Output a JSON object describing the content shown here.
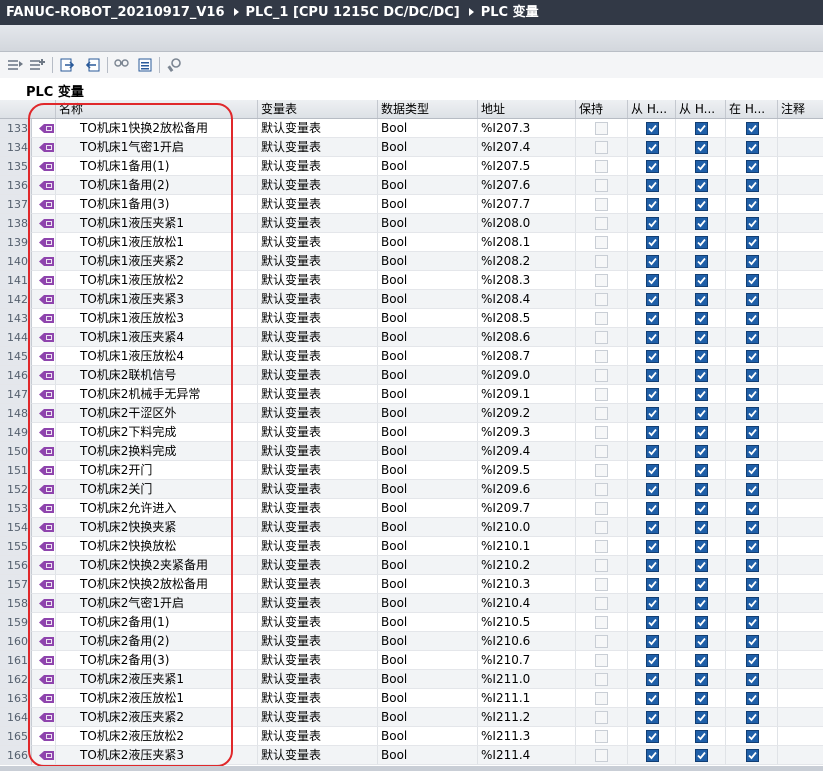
{
  "titlebar": {
    "crumbs": [
      "FANUC-ROBOT_20210917_V16",
      "PLC_1 [CPU 1215C DC/DC/DC]",
      "PLC 变量"
    ]
  },
  "section_title": "PLC 变量",
  "toolbar_icons": [
    "insert-row-icon",
    "add-row-icon",
    "export-icon",
    "import-icon",
    "monitor-icon",
    "show-all-icon",
    "settings-icon"
  ],
  "columns": {
    "name": "名称",
    "table": "变量表",
    "datatype": "数据类型",
    "address": "地址",
    "retain": "保持",
    "from_hmi1": "从 H...",
    "from_hmi2": "从 H...",
    "in_hmi": "在 H...",
    "comment": "注释"
  },
  "colors": {
    "titlebar_bg": "#323946",
    "checkbox_checked": "#1f5fa8",
    "highlight_box": "#e0282b",
    "tag_icon": "#8e44ad"
  },
  "rows": [
    {
      "n": "133",
      "name": "TO机床1快换2放松备用",
      "table": "默认变量表",
      "type": "Bool",
      "addr": "%I207.3",
      "retain": false,
      "h1": true,
      "h2": true,
      "h3": true
    },
    {
      "n": "134",
      "name": "TO机床1气密1开启",
      "table": "默认变量表",
      "type": "Bool",
      "addr": "%I207.4",
      "retain": false,
      "h1": true,
      "h2": true,
      "h3": true
    },
    {
      "n": "135",
      "name": "TO机床1备用(1)",
      "table": "默认变量表",
      "type": "Bool",
      "addr": "%I207.5",
      "retain": false,
      "h1": true,
      "h2": true,
      "h3": true
    },
    {
      "n": "136",
      "name": "TO机床1备用(2)",
      "table": "默认变量表",
      "type": "Bool",
      "addr": "%I207.6",
      "retain": false,
      "h1": true,
      "h2": true,
      "h3": true
    },
    {
      "n": "137",
      "name": "TO机床1备用(3)",
      "table": "默认变量表",
      "type": "Bool",
      "addr": "%I207.7",
      "retain": false,
      "h1": true,
      "h2": true,
      "h3": true
    },
    {
      "n": "138",
      "name": "TO机床1液压夹紧1",
      "table": "默认变量表",
      "type": "Bool",
      "addr": "%I208.0",
      "retain": false,
      "h1": true,
      "h2": true,
      "h3": true
    },
    {
      "n": "139",
      "name": "TO机床1液压放松1",
      "table": "默认变量表",
      "type": "Bool",
      "addr": "%I208.1",
      "retain": false,
      "h1": true,
      "h2": true,
      "h3": true
    },
    {
      "n": "140",
      "name": "TO机床1液压夹紧2",
      "table": "默认变量表",
      "type": "Bool",
      "addr": "%I208.2",
      "retain": false,
      "h1": true,
      "h2": true,
      "h3": true
    },
    {
      "n": "141",
      "name": "TO机床1液压放松2",
      "table": "默认变量表",
      "type": "Bool",
      "addr": "%I208.3",
      "retain": false,
      "h1": true,
      "h2": true,
      "h3": true
    },
    {
      "n": "142",
      "name": "TO机床1液压夹紧3",
      "table": "默认变量表",
      "type": "Bool",
      "addr": "%I208.4",
      "retain": false,
      "h1": true,
      "h2": true,
      "h3": true
    },
    {
      "n": "143",
      "name": "TO机床1液压放松3",
      "table": "默认变量表",
      "type": "Bool",
      "addr": "%I208.5",
      "retain": false,
      "h1": true,
      "h2": true,
      "h3": true
    },
    {
      "n": "144",
      "name": "TO机床1液压夹紧4",
      "table": "默认变量表",
      "type": "Bool",
      "addr": "%I208.6",
      "retain": false,
      "h1": true,
      "h2": true,
      "h3": true
    },
    {
      "n": "145",
      "name": "TO机床1液压放松4",
      "table": "默认变量表",
      "type": "Bool",
      "addr": "%I208.7",
      "retain": false,
      "h1": true,
      "h2": true,
      "h3": true
    },
    {
      "n": "146",
      "name": "TO机床2联机信号",
      "table": "默认变量表",
      "type": "Bool",
      "addr": "%I209.0",
      "retain": false,
      "h1": true,
      "h2": true,
      "h3": true
    },
    {
      "n": "147",
      "name": "TO机床2机械手无异常",
      "table": "默认变量表",
      "type": "Bool",
      "addr": "%I209.1",
      "retain": false,
      "h1": true,
      "h2": true,
      "h3": true
    },
    {
      "n": "148",
      "name": "TO机床2干涩区外",
      "table": "默认变量表",
      "type": "Bool",
      "addr": "%I209.2",
      "retain": false,
      "h1": true,
      "h2": true,
      "h3": true
    },
    {
      "n": "149",
      "name": "TO机床2下料完成",
      "table": "默认变量表",
      "type": "Bool",
      "addr": "%I209.3",
      "retain": false,
      "h1": true,
      "h2": true,
      "h3": true
    },
    {
      "n": "150",
      "name": "TO机床2换料完成",
      "table": "默认变量表",
      "type": "Bool",
      "addr": "%I209.4",
      "retain": false,
      "h1": true,
      "h2": true,
      "h3": true
    },
    {
      "n": "151",
      "name": "TO机床2开门",
      "table": "默认变量表",
      "type": "Bool",
      "addr": "%I209.5",
      "retain": false,
      "h1": true,
      "h2": true,
      "h3": true
    },
    {
      "n": "152",
      "name": "TO机床2关门",
      "table": "默认变量表",
      "type": "Bool",
      "addr": "%I209.6",
      "retain": false,
      "h1": true,
      "h2": true,
      "h3": true
    },
    {
      "n": "153",
      "name": "TO机床2允许进入",
      "table": "默认变量表",
      "type": "Bool",
      "addr": "%I209.7",
      "retain": false,
      "h1": true,
      "h2": true,
      "h3": true
    },
    {
      "n": "154",
      "name": "TO机床2快换夹紧",
      "table": "默认变量表",
      "type": "Bool",
      "addr": "%I210.0",
      "retain": false,
      "h1": true,
      "h2": true,
      "h3": true
    },
    {
      "n": "155",
      "name": "TO机床2快换放松",
      "table": "默认变量表",
      "type": "Bool",
      "addr": "%I210.1",
      "retain": false,
      "h1": true,
      "h2": true,
      "h3": true
    },
    {
      "n": "156",
      "name": "TO机床2快换2夹紧备用",
      "table": "默认变量表",
      "type": "Bool",
      "addr": "%I210.2",
      "retain": false,
      "h1": true,
      "h2": true,
      "h3": true
    },
    {
      "n": "157",
      "name": "TO机床2快换2放松备用",
      "table": "默认变量表",
      "type": "Bool",
      "addr": "%I210.3",
      "retain": false,
      "h1": true,
      "h2": true,
      "h3": true
    },
    {
      "n": "158",
      "name": "TO机床2气密1开启",
      "table": "默认变量表",
      "type": "Bool",
      "addr": "%I210.4",
      "retain": false,
      "h1": true,
      "h2": true,
      "h3": true
    },
    {
      "n": "159",
      "name": "TO机床2备用(1)",
      "table": "默认变量表",
      "type": "Bool",
      "addr": "%I210.5",
      "retain": false,
      "h1": true,
      "h2": true,
      "h3": true
    },
    {
      "n": "160",
      "name": "TO机床2备用(2)",
      "table": "默认变量表",
      "type": "Bool",
      "addr": "%I210.6",
      "retain": false,
      "h1": true,
      "h2": true,
      "h3": true
    },
    {
      "n": "161",
      "name": "TO机床2备用(3)",
      "table": "默认变量表",
      "type": "Bool",
      "addr": "%I210.7",
      "retain": false,
      "h1": true,
      "h2": true,
      "h3": true
    },
    {
      "n": "162",
      "name": "TO机床2液压夹紧1",
      "table": "默认变量表",
      "type": "Bool",
      "addr": "%I211.0",
      "retain": false,
      "h1": true,
      "h2": true,
      "h3": true
    },
    {
      "n": "163",
      "name": "TO机床2液压放松1",
      "table": "默认变量表",
      "type": "Bool",
      "addr": "%I211.1",
      "retain": false,
      "h1": true,
      "h2": true,
      "h3": true
    },
    {
      "n": "164",
      "name": "TO机床2液压夹紧2",
      "table": "默认变量表",
      "type": "Bool",
      "addr": "%I211.2",
      "retain": false,
      "h1": true,
      "h2": true,
      "h3": true
    },
    {
      "n": "165",
      "name": "TO机床2液压放松2",
      "table": "默认变量表",
      "type": "Bool",
      "addr": "%I211.3",
      "retain": false,
      "h1": true,
      "h2": true,
      "h3": true
    },
    {
      "n": "166",
      "name": "TO机床2液压夹紧3",
      "table": "默认变量表",
      "type": "Bool",
      "addr": "%I211.4",
      "retain": false,
      "h1": true,
      "h2": true,
      "h3": true
    }
  ]
}
